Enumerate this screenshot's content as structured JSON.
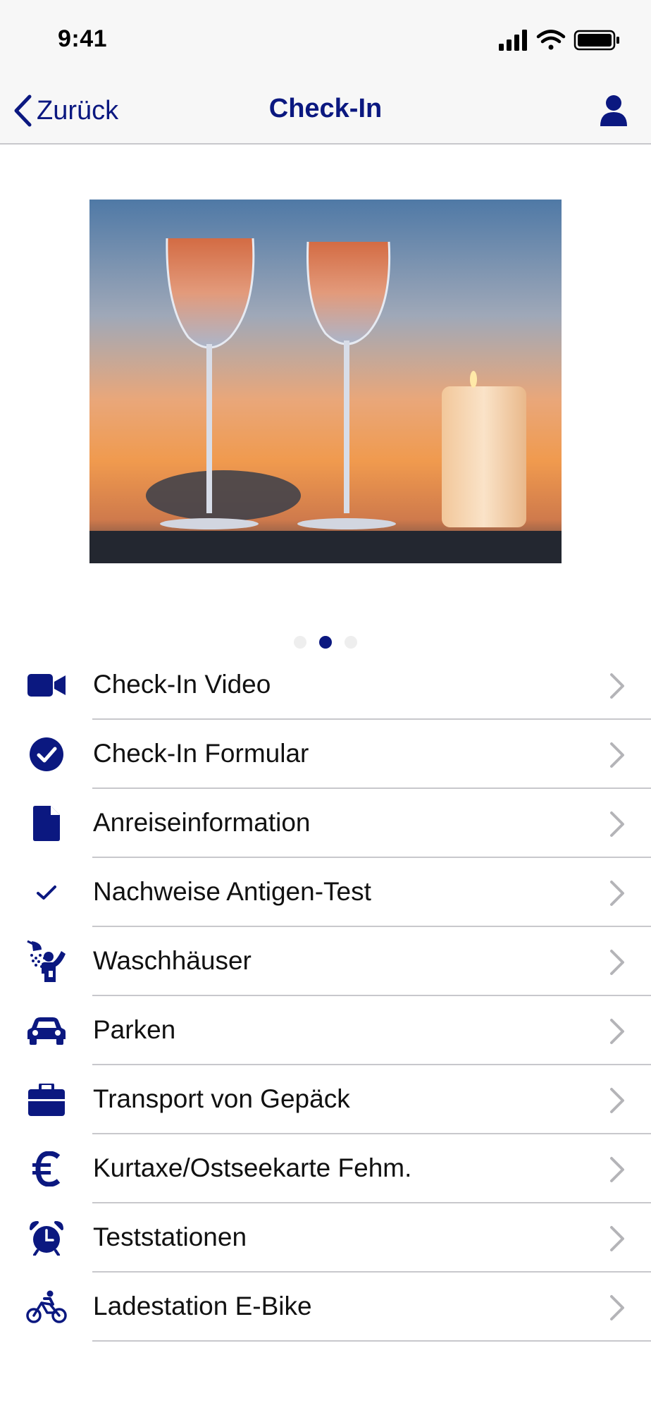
{
  "status_bar": {
    "time": "9:41"
  },
  "nav": {
    "back_label": "Zurück",
    "title": "Check-In"
  },
  "carousel": {
    "page_count": 3,
    "active_page": 2
  },
  "colors": {
    "brand": "#0b1880",
    "separator": "#c8c8cc",
    "chevron": "#b4b4b8"
  },
  "menu": {
    "items": [
      {
        "label": "Check-In Video",
        "icon": "video-camera-icon"
      },
      {
        "label": "Check-In Formular",
        "icon": "check-circle-icon"
      },
      {
        "label": "Anreiseinformation",
        "icon": "document-icon"
      },
      {
        "label": "Nachweise Antigen-Test",
        "icon": "checkmark-icon"
      },
      {
        "label": "Waschhäuser",
        "icon": "shower-icon"
      },
      {
        "label": "Parken",
        "icon": "car-icon"
      },
      {
        "label": "Transport von Gepäck",
        "icon": "briefcase-icon"
      },
      {
        "label": "Kurtaxe/Ostseekarte Fehm.",
        "icon": "euro-icon"
      },
      {
        "label": "Teststationen",
        "icon": "alarm-clock-icon"
      },
      {
        "label": "Ladestation E-Bike",
        "icon": "bicycle-icon"
      }
    ]
  }
}
